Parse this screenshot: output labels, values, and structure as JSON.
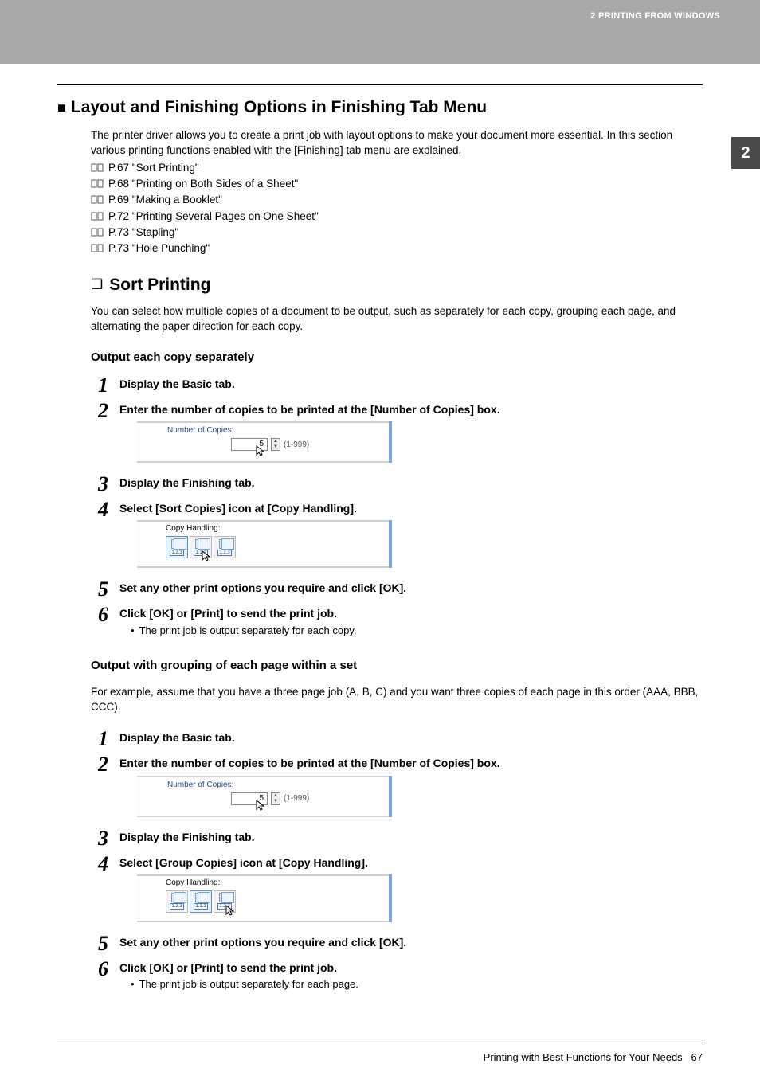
{
  "header": {
    "crumb": "2 PRINTING FROM WINDOWS"
  },
  "side_tab": "2",
  "main_heading": "Layout and Finishing Options in Finishing Tab Menu",
  "intro": "The printer driver allows you to create a print job with layout options to make your document more essential.  In this section various printing functions enabled with the [Finishing] tab menu are explained.",
  "refs": [
    "P.67 \"Sort Printing\"",
    "P.68 \"Printing on Both Sides of a Sheet\"",
    "P.69 \"Making a Booklet\"",
    "P.72 \"Printing Several Pages on One Sheet\"",
    "P.73 \"Stapling\"",
    "P.73 \"Hole Punching\""
  ],
  "sub_heading": "Sort Printing",
  "sub_intro": "You can select how multiple copies of a document to be output, such as separately for each copy, grouping each page, and alternating the paper direction for each copy.",
  "section_a": {
    "title": "Output each copy separately",
    "steps": [
      {
        "title": "Display the Basic tab."
      },
      {
        "title": "Enter the number of copies to be printed at the [Number of Copies] box.",
        "noc": true
      },
      {
        "title": "Display the Finishing tab."
      },
      {
        "title": "Select [Sort Copies] icon at [Copy Handling].",
        "ch": "sort"
      },
      {
        "title": "Set any other print options you require and click [OK]."
      },
      {
        "title": "Click [OK] or [Print] to send the print job.",
        "bullet": "The print job is output separately for each copy."
      }
    ]
  },
  "section_b": {
    "title": "Output with grouping of each page within a set",
    "para": "For example, assume that you have a three page job (A, B, C) and you want three copies of each page in this order (AAA, BBB, CCC).",
    "steps": [
      {
        "title": "Display the Basic tab."
      },
      {
        "title": "Enter the number of copies to be printed at the [Number of Copies] box.",
        "noc": true
      },
      {
        "title": "Display the Finishing tab."
      },
      {
        "title": "Select [Group Copies] icon at [Copy Handling].",
        "ch": "group"
      },
      {
        "title": "Set any other print options you require and click [OK]."
      },
      {
        "title": "Click [OK] or [Print] to send the print job.",
        "bullet": "The print job is output separately for each page."
      }
    ]
  },
  "noc_shot": {
    "label": "Number of Copies:",
    "value": "5",
    "range": "(1-999)"
  },
  "ch_shot": {
    "label": "Copy Handling:",
    "icons": [
      {
        "lbl": "1.2.3"
      },
      {
        "lbl": "1.1.1"
      },
      {
        "lbl": "1.2.3"
      }
    ]
  },
  "footer": {
    "text": "Printing with Best Functions for Your Needs",
    "page": "67"
  }
}
